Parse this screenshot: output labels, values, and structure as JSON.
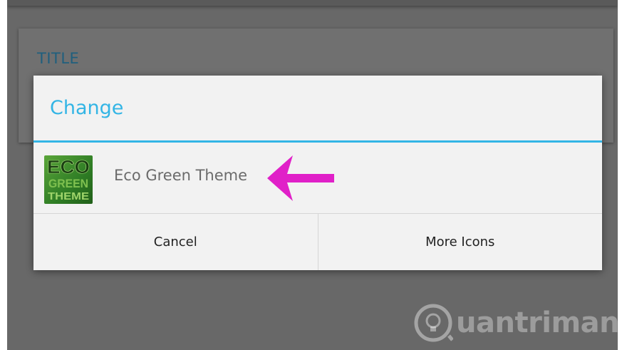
{
  "background": {
    "card_title": "TITLE"
  },
  "dialog": {
    "title": "Change",
    "accent_color": "#33b5e5",
    "items": [
      {
        "label": "Eco Green Theme",
        "icon": "eco-green-theme-icon",
        "icon_text": [
          "ECO",
          "GREEN",
          "THEME"
        ]
      }
    ],
    "buttons": {
      "cancel": "Cancel",
      "more_icons": "More Icons"
    }
  },
  "annotation": {
    "arrow_color": "#e020c8",
    "points_to": "Eco Green Theme"
  },
  "watermark": {
    "text": "uantrimang",
    "icon": "lightbulb-icon"
  }
}
